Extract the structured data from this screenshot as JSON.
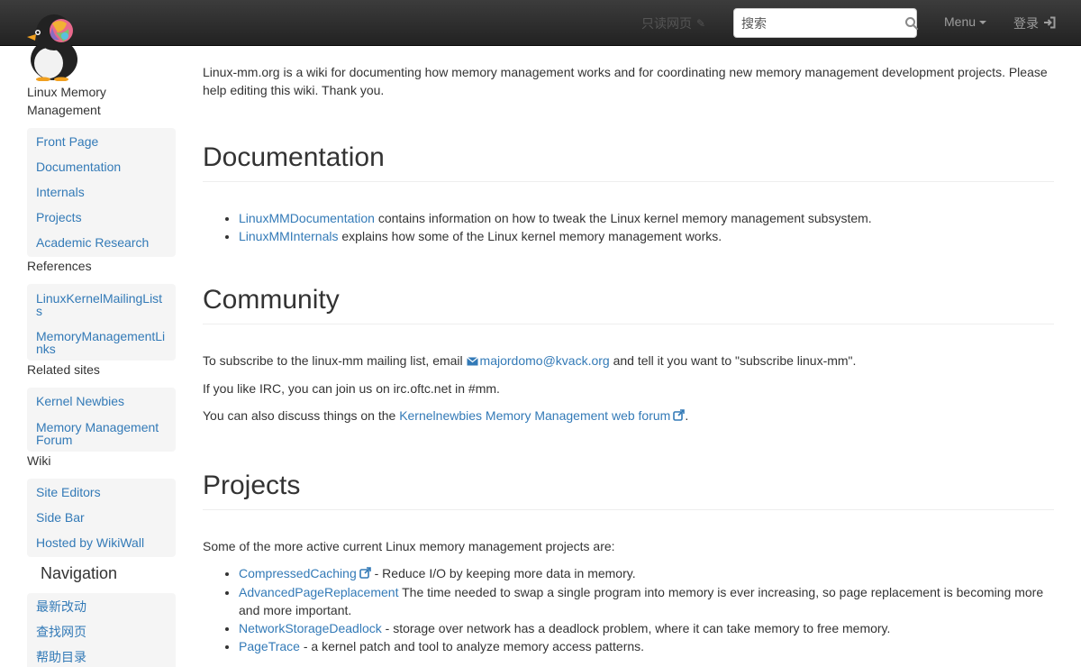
{
  "navbar": {
    "readonly_label": "只读网页",
    "search_placeholder": "搜索",
    "menu_label": "Menu",
    "login_label": "登录"
  },
  "sidebar": {
    "site_title": "Linux Memory Management",
    "main_items": [
      {
        "label": "Front Page"
      },
      {
        "label": "Documentation"
      },
      {
        "label": "Internals"
      },
      {
        "label": "Projects"
      },
      {
        "label": "Academic Research"
      }
    ],
    "references_title": "References",
    "references_items": [
      {
        "label": "LinuxKernelMailingLists"
      },
      {
        "label": "MemoryManagementLinks"
      }
    ],
    "related_title": "Related sites",
    "related_items": [
      {
        "label": "Kernel Newbies"
      },
      {
        "label": "Memory Management Forum"
      }
    ],
    "wiki_title": "Wiki",
    "wiki_items": [
      {
        "label": "Site Editors"
      },
      {
        "label": "Side Bar"
      },
      {
        "label": "Hosted by WikiWall"
      }
    ],
    "navigation_heading": "Navigation",
    "navigation_items": [
      {
        "label": "最新改动"
      },
      {
        "label": "查找网页"
      },
      {
        "label": "帮助目录"
      }
    ]
  },
  "main": {
    "intro": "Linux-mm.org is a wiki for documenting how memory management works and for coordinating new memory management development projects. Please help editing this wiki. Thank you.",
    "documentation": {
      "heading": "Documentation",
      "items": [
        {
          "link": "LinuxMMDocumentation",
          "text": " contains information on how to tweak the Linux kernel memory management subsystem."
        },
        {
          "link": "LinuxMMInternals",
          "text": " explains how some of the Linux kernel memory management works."
        }
      ]
    },
    "community": {
      "heading": "Community",
      "subscribe_prefix": "To subscribe to the linux-mm mailing list, email ",
      "subscribe_email": "majordomo@kvack.org",
      "subscribe_suffix": " and tell it you want to \"subscribe linux-mm\".",
      "irc": "If you like IRC, you can join us on irc.oftc.net in #mm.",
      "forum_prefix": "You can also discuss things on the ",
      "forum_link": "Kernelnewbies Memory Management web forum",
      "forum_suffix": "."
    },
    "projects": {
      "heading": "Projects",
      "intro": "Some of the more active current Linux memory management projects are:",
      "items": [
        {
          "link": "CompressedCaching",
          "text": " - Reduce I/O by keeping more data in memory.",
          "external": true
        },
        {
          "link": "AdvancedPageReplacement",
          "text": " The time needed to swap a single program into memory is ever increasing, so page replacement is becoming more and more important.",
          "external": false
        },
        {
          "link": "NetworkStorageDeadlock",
          "text": " - storage over network has a deadlock problem, where it can take memory to free memory.",
          "external": false
        },
        {
          "link": "PageTrace",
          "text": " - a kernel patch and tool to analyze memory access patterns.",
          "external": false
        }
      ]
    }
  },
  "colors": {
    "link": "#337ab7",
    "navbar_top": "#3c3c3c",
    "navbar_bottom": "#222222",
    "sidebar_bg": "#f5f5f5"
  }
}
